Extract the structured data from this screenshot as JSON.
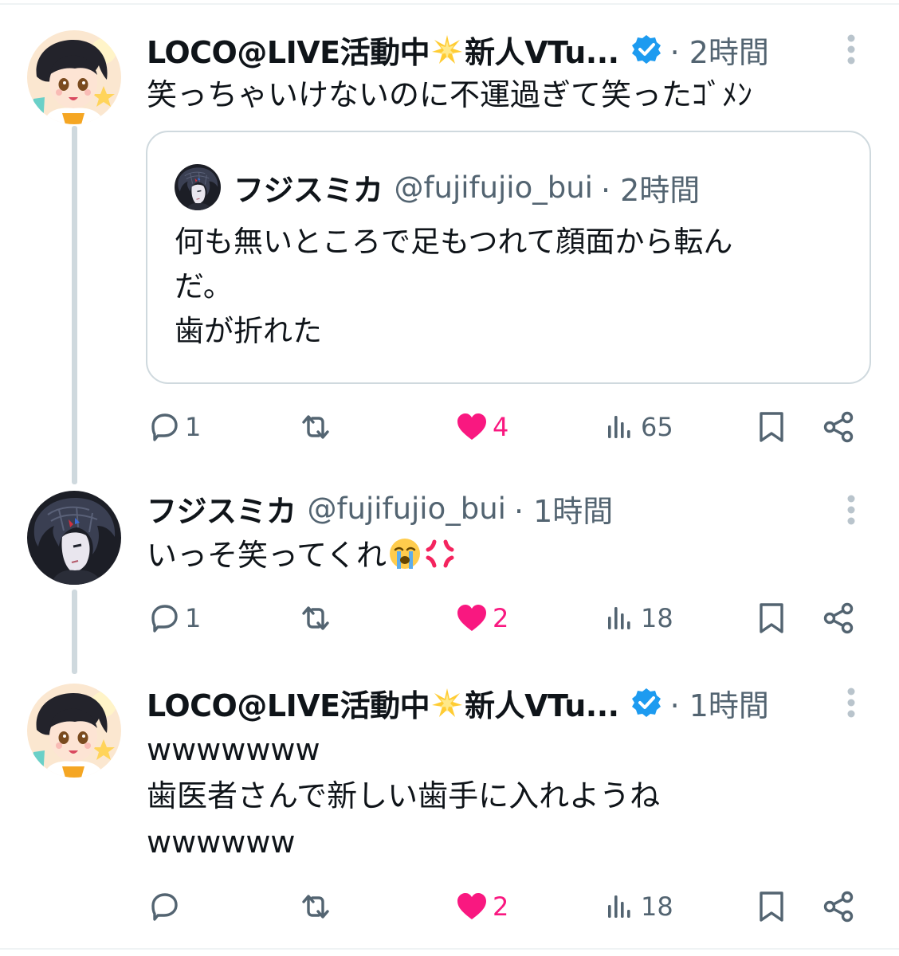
{
  "tweets": [
    {
      "author_name": "LOCO@LIVE活動中",
      "author_name_suffix": "新人VTu...",
      "verified": true,
      "time": "· 2時間",
      "text": "笑っちゃいけないのに不運過ぎて笑ったｺﾞﾒﾝ",
      "quote": {
        "author_name": "フジスミカ",
        "handle": "@fujifujio_bui",
        "time": "· 2時間",
        "text": "何も無いところで足もつれて顔面から転ん\nだ。\n歯が折れた"
      },
      "actions": {
        "replies": "1",
        "liked": true,
        "likes": "4",
        "views": "65"
      }
    },
    {
      "author_name": "フジスミカ",
      "handle": "@fujifujio_bui",
      "time": "· 1時間",
      "text": "いっそ笑ってくれ",
      "emojis": [
        "loudly-crying-face",
        "anger-symbol"
      ],
      "actions": {
        "replies": "1",
        "liked": true,
        "likes": "2",
        "views": "18"
      }
    },
    {
      "author_name": "LOCO@LIVE活動中",
      "author_name_suffix": "新人VTu...",
      "verified": true,
      "time": "· 1時間",
      "text_lines": [
        "wwwwwww",
        "歯医者さんで新しい歯手に入れようね",
        "wwwwww"
      ],
      "actions": {
        "replies": "",
        "liked": true,
        "likes": "2",
        "views": "18"
      }
    }
  ],
  "colors": {
    "like": "#f91880",
    "verified": "#1d9bf0",
    "secondary": "#536471",
    "thread_line": "#cfd9de"
  }
}
